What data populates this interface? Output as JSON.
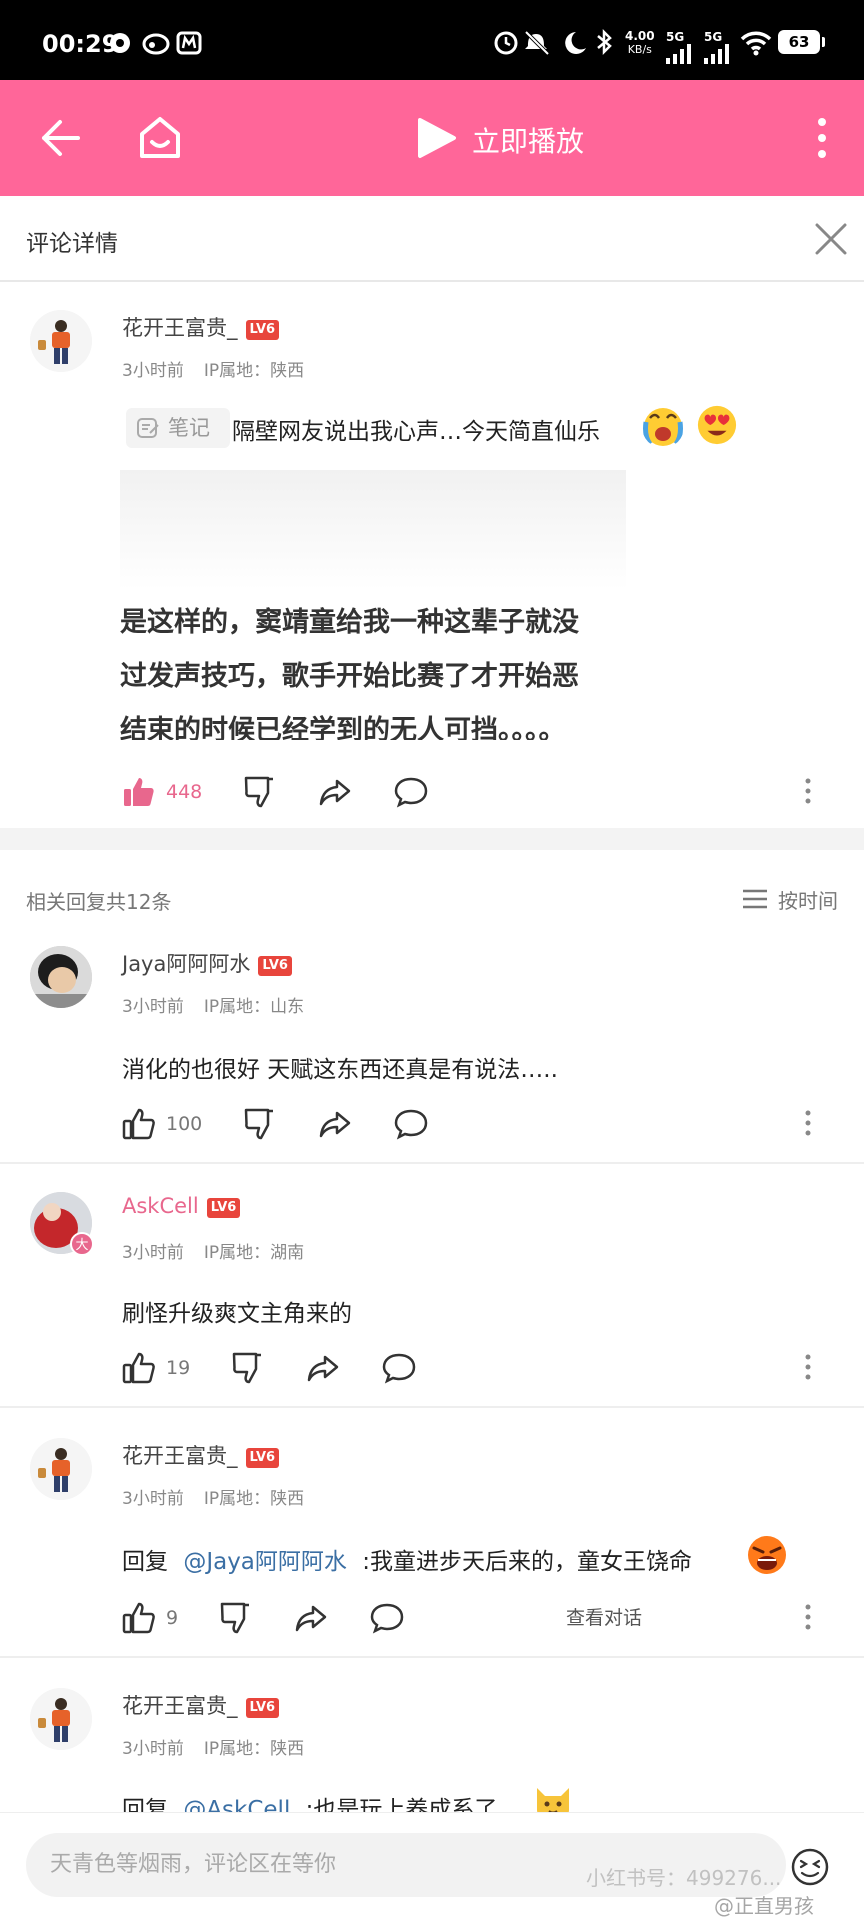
{
  "status_bar": {
    "time": "00:29",
    "speed_top": "4.00",
    "speed_unit": "KB/s",
    "net1": "5G",
    "net2": "5G",
    "battery": "63"
  },
  "header": {
    "play_label": "立即播放"
  },
  "detail": {
    "title": "评论详情"
  },
  "main_comment": {
    "username": "花开王富贵_",
    "level": "LV6",
    "time": "3小时前",
    "ip": "IP属地：陕西",
    "note_tag": "笔记",
    "note_title": "隔壁网友说出我心声…今天简直仙乐",
    "snapshot_lines": [
      "是这样的，窦靖童给我一种这辈子就没",
      "过发声技巧，歌手开始比赛了才开始恶",
      "结束的时候已经学到的无人可挡。。。。"
    ],
    "likes": "448"
  },
  "replies_header": {
    "label": "相关回复共12条",
    "sort": "按时间"
  },
  "replies": [
    {
      "username": "Jaya阿阿阿水",
      "level": "LV6",
      "time": "3小时前",
      "ip": "IP属地：山东",
      "text": "消化的也很好  天赋这东西还真是有说法…..",
      "likes": "100"
    },
    {
      "username": "AskCell",
      "level": "LV6",
      "time": "3小时前",
      "ip": "IP属地：湖南",
      "text": "刷怪升级爽文主角来的",
      "likes": "19",
      "badge": "大"
    },
    {
      "username": "花开王富贵_",
      "level": "LV6",
      "time": "3小时前",
      "ip": "IP属地：陕西",
      "reply_prefix": "回复",
      "mention": "@Jaya阿阿阿水",
      "text": ":我童进步天后来的，童女王饶命",
      "likes": "9",
      "view_chat": "查看对话"
    },
    {
      "username": "花开王富贵_",
      "level": "LV6",
      "time": "3小时前",
      "ip": "IP属地：陕西",
      "reply_prefix": "回复",
      "mention": "@AskCell",
      "text": ":也是玩上养成系了"
    }
  ],
  "bottom": {
    "placeholder": "天青色等烟雨，评论区在等你",
    "watermark1": "小红书号：499276...",
    "watermark2": "@正直男孩"
  },
  "colors": {
    "brand_pink": "#ff6699",
    "like_pink": "#e8678d",
    "level_red": "#e8453c",
    "mention_blue": "#3b6fa4"
  }
}
